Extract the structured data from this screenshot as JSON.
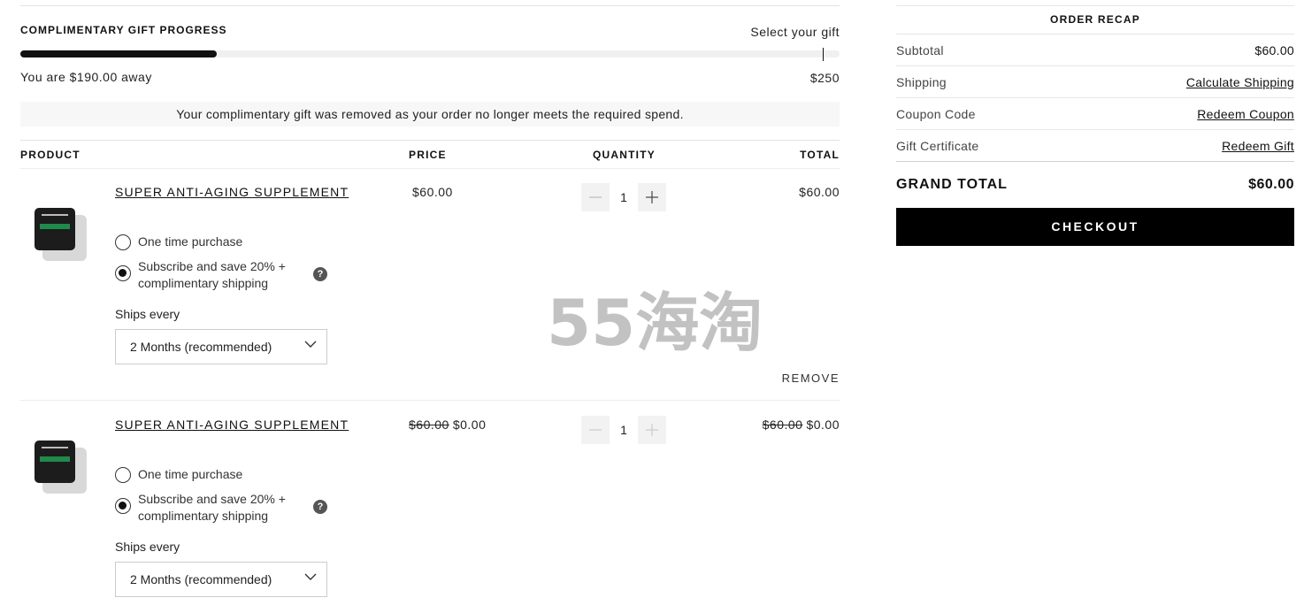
{
  "gift_progress": {
    "title": "COMPLIMENTARY GIFT PROGRESS",
    "select_label": "Select your gift",
    "away_text": "You are $190.00 away",
    "goal_amount": "$250",
    "progress_fraction": 0.24
  },
  "notice": "Your complimentary gift was removed as your order no longer meets the required spend.",
  "table_headers": {
    "product": "PRODUCT",
    "price": "PRICE",
    "quantity": "QUANTITY",
    "total": "TOTAL"
  },
  "items": [
    {
      "name": "SUPER ANTI-AGING SUPPLEMENT",
      "price": "$60.00",
      "original_price": "",
      "quantity": "1",
      "total": "$60.00",
      "original_total": "",
      "option_one_time": "One time purchase",
      "option_subscribe": "Subscribe and save 20% + complimentary shipping",
      "help_glyph": "?",
      "ships_every_label": "Ships every",
      "ships_every_value": "2 Months (recommended)",
      "remove_label": "REMOVE"
    },
    {
      "name": "SUPER ANTI-AGING SUPPLEMENT",
      "price": "$0.00",
      "original_price": "$60.00",
      "quantity": "1",
      "total": "$0.00",
      "original_total": "$60.00",
      "option_one_time": "One time purchase",
      "option_subscribe": "Subscribe and save 20% + complimentary shipping",
      "help_glyph": "?",
      "ships_every_label": "Ships every",
      "ships_every_value": "2 Months (recommended)"
    }
  ],
  "watermark": "55海淘",
  "order_recap": {
    "title": "ORDER RECAP",
    "rows": [
      {
        "label": "Subtotal",
        "value": "$60.00"
      },
      {
        "label": "Shipping",
        "value": "Calculate Shipping"
      },
      {
        "label": "Coupon Code",
        "value": "Redeem Coupon"
      },
      {
        "label": "Gift Certificate",
        "value": "Redeem Gift"
      }
    ],
    "grand_total_label": "GRAND TOTAL",
    "grand_total_value": "$60.00",
    "checkout_label": "CHECKOUT"
  },
  "colors": {
    "accent": "#000000",
    "progress_fill": "#111111",
    "jar_stripe": "#1f8a4c"
  },
  "icons": [
    "help-icon",
    "chevron-down-icon",
    "minus-icon",
    "plus-icon",
    "product-thumbnail"
  ]
}
